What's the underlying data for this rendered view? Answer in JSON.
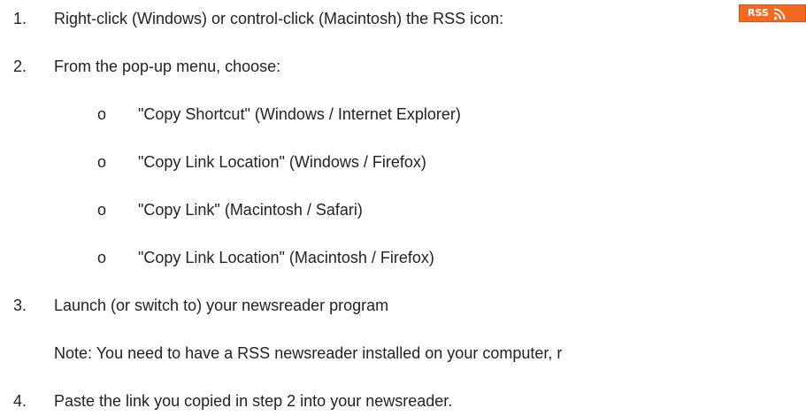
{
  "steps": [
    {
      "num": "1.",
      "text": "Right-click (Windows) or control-click (Macintosh) the RSS icon:"
    },
    {
      "num": "2.",
      "text": "From the pop-up menu, choose:"
    },
    {
      "num": "3.",
      "text": "Launch (or switch to) your newsreader program"
    },
    {
      "num": "4.",
      "text": "Paste the link you copied in step 2 into your newsreader."
    }
  ],
  "bullet_glyph": "o",
  "options": [
    "\"Copy Shortcut\" (Windows / Internet Explorer)",
    "\"Copy Link Location\" (Windows / Firefox)",
    "\"Copy Link\" (Macintosh / Safari)",
    "\"Copy Link Location\" (Macintosh / Firefox)"
  ],
  "note": "Note: You need to have a RSS newsreader installed on your computer, r",
  "rss_badge": {
    "label": "RSS",
    "icon": "rss-feed-icon",
    "color": "#f26a21"
  }
}
